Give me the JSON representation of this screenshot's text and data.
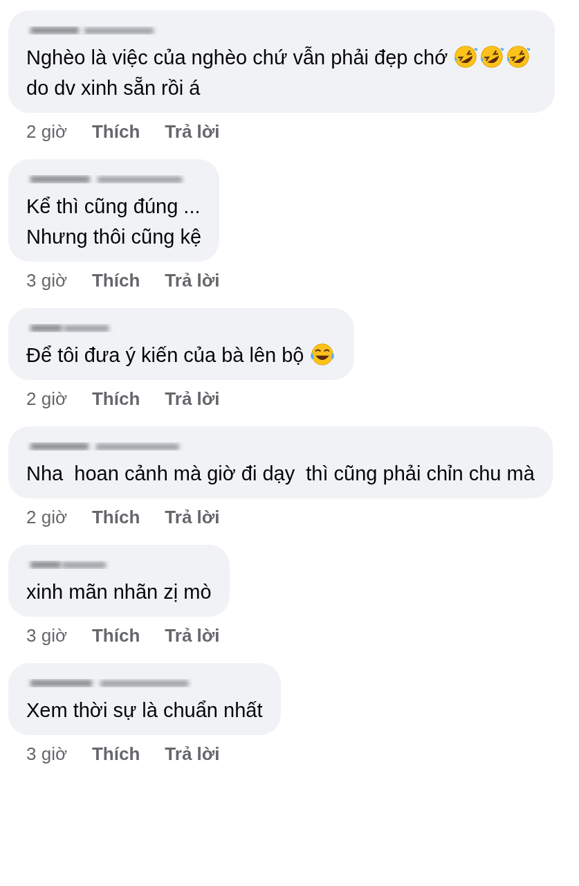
{
  "comments": [
    {
      "segments": [
        {
          "kind": "text",
          "text": "Nghèo là việc của nghèo chứ vẫn phải đẹp chớ "
        },
        {
          "kind": "rofl"
        },
        {
          "kind": "rofl"
        },
        {
          "kind": "rofl"
        },
        {
          "kind": "text",
          "text": "do dv xinh sẵn rồi á"
        }
      ],
      "time": "2 giờ",
      "like": "Thích",
      "reply": "Trả lời"
    },
    {
      "segments": [
        {
          "kind": "text",
          "text": "Kể thì cũng đúng ...\nNhưng thôi cũng kệ"
        }
      ],
      "time": "3 giờ",
      "like": "Thích",
      "reply": "Trả lời"
    },
    {
      "segments": [
        {
          "kind": "text",
          "text": "Để tôi đưa ý kiến của bà lên bộ "
        },
        {
          "kind": "joy"
        }
      ],
      "time": "2 giờ",
      "like": "Thích",
      "reply": "Trả lời"
    },
    {
      "segments": [
        {
          "kind": "text",
          "text": "Nha  hoan cảnh mà giờ đi dạy  thì cũng phải chỉn chu mà"
        }
      ],
      "time": "2 giờ",
      "like": "Thích",
      "reply": "Trả lời"
    },
    {
      "segments": [
        {
          "kind": "text",
          "text": "xinh mãn nhãn zị mò"
        }
      ],
      "time": "3 giờ",
      "like": "Thích",
      "reply": "Trả lời"
    },
    {
      "segments": [
        {
          "kind": "text",
          "text": "Xem thời sự là chuẩn nhất"
        }
      ],
      "time": "3 giờ",
      "like": "Thích",
      "reply": "Trả lời"
    }
  ]
}
